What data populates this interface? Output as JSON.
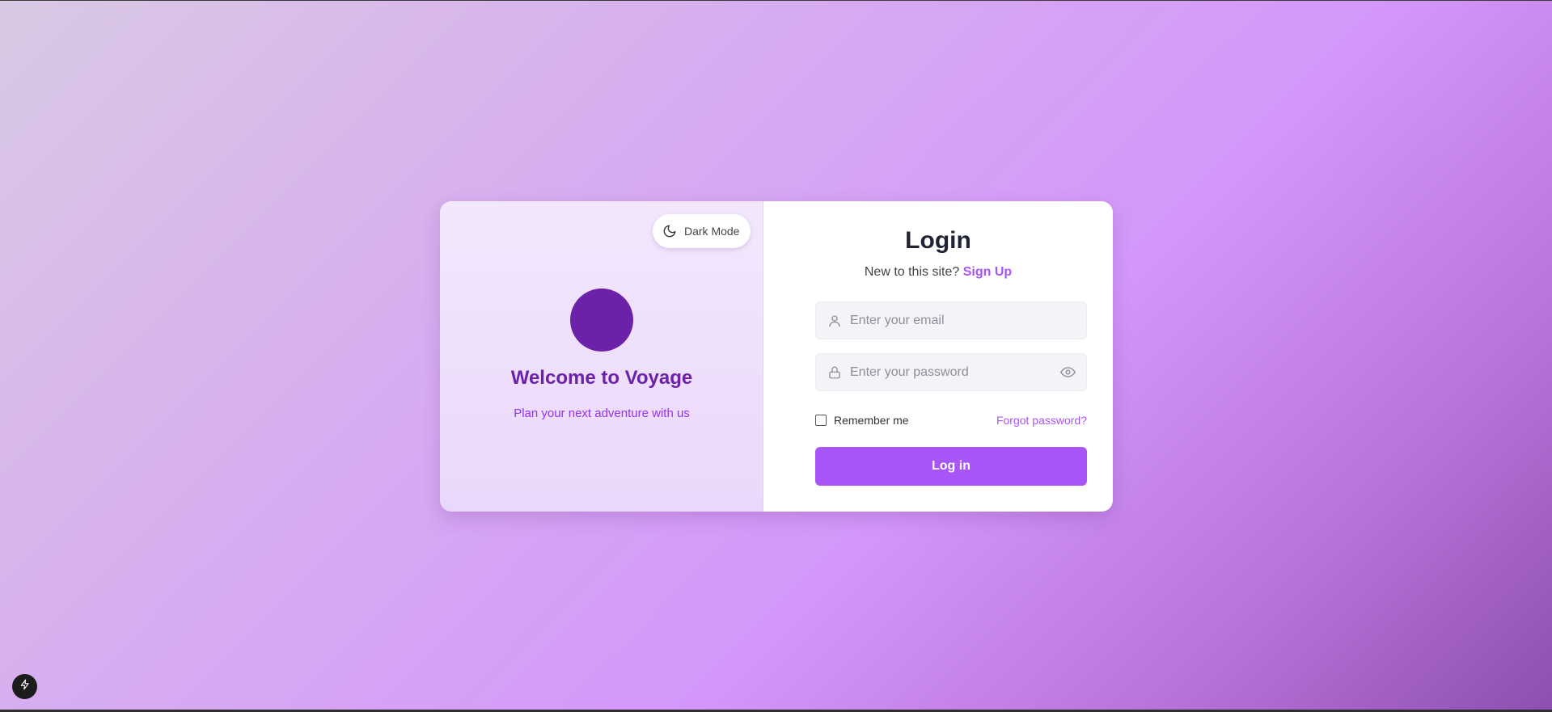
{
  "theme": {
    "accent": "#a855f7",
    "brand": "#6b21a8"
  },
  "left_panel": {
    "dark_mode_label": "Dark Mode",
    "dark_mode_icon": "moon-icon",
    "welcome_title": "Welcome to Voyage",
    "welcome_subtitle": "Plan your next adventure with us"
  },
  "login": {
    "title": "Login",
    "signup_prompt": "New to this site?",
    "signup_link": "Sign Up",
    "email": {
      "value": "",
      "placeholder": "Enter your email",
      "icon": "user-icon"
    },
    "password": {
      "value": "",
      "placeholder": "Enter your password",
      "icon": "lock-icon",
      "toggle_icon": "eye-icon"
    },
    "remember_label": "Remember me",
    "remember_checked": false,
    "forgot_link": "Forgot password?",
    "submit_label": "Log in"
  },
  "corner_badge": {
    "icon": "lightning-icon"
  }
}
